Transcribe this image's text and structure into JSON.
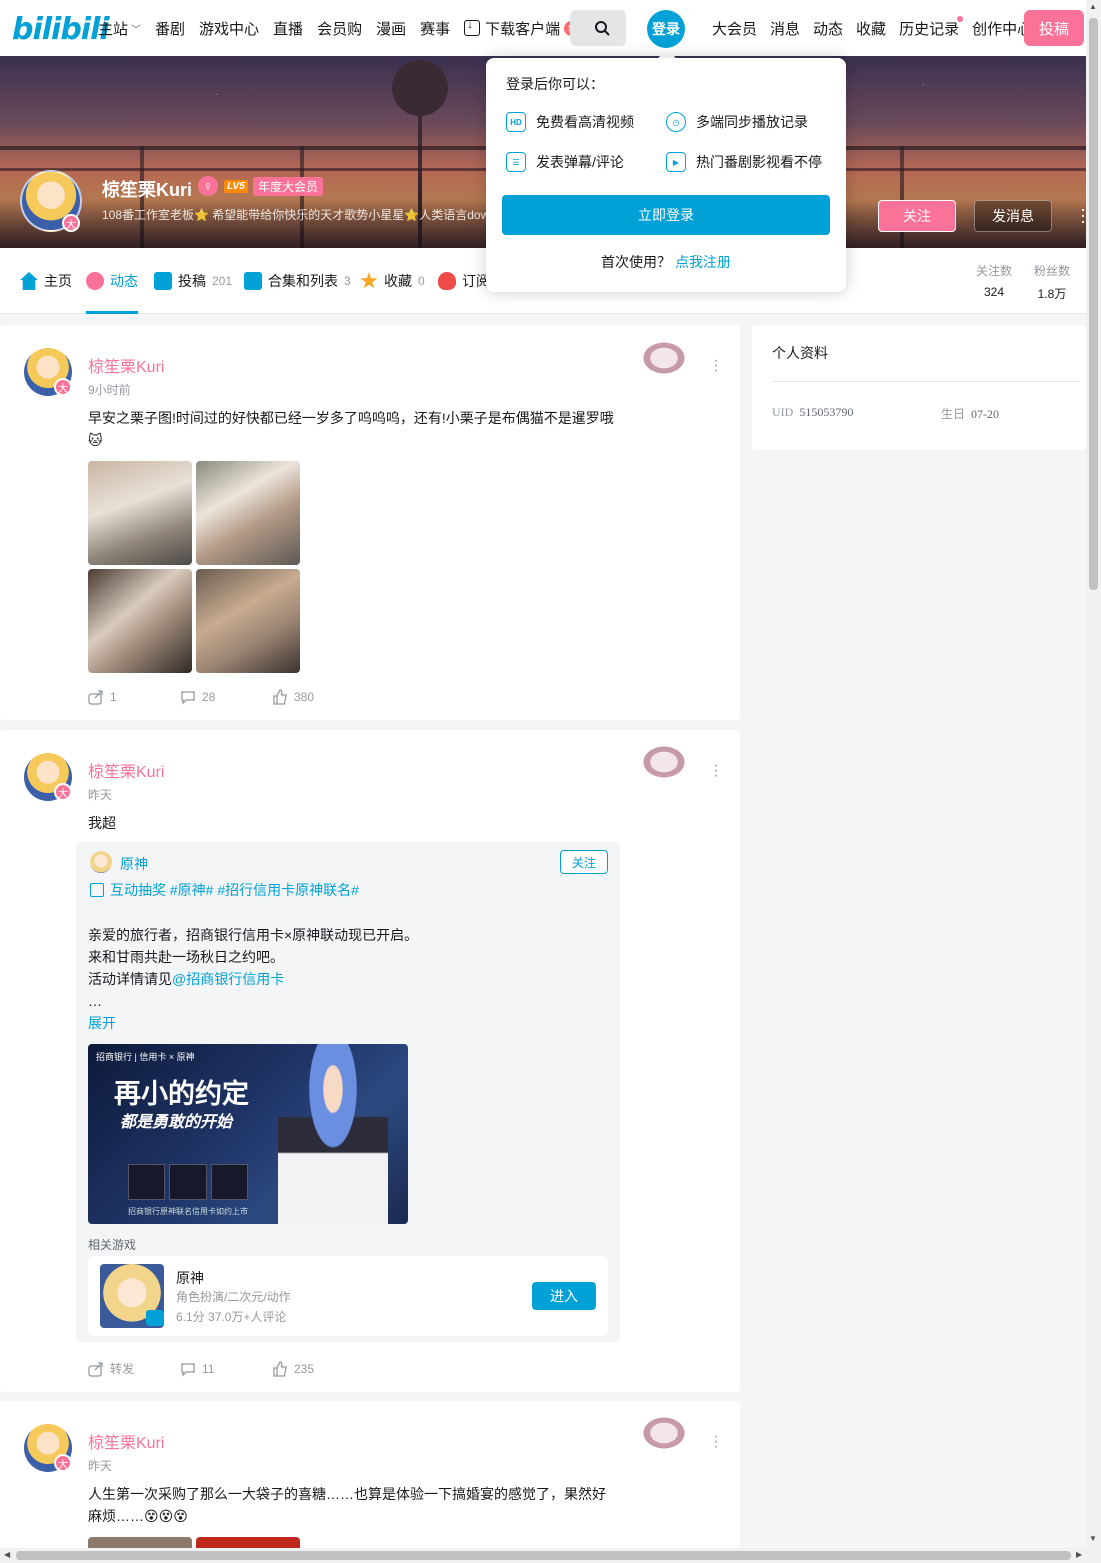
{
  "header": {
    "logo": "bilibili",
    "nav_left": [
      "主站",
      "番剧",
      "游戏中心",
      "直播",
      "会员购",
      "漫画",
      "赛事"
    ],
    "download": "下载客户端",
    "download_badge": "新",
    "login_avatar_label": "登录",
    "nav_right": [
      "大会员",
      "消息",
      "动态",
      "收藏",
      "历史记录",
      "创作中心"
    ],
    "upload": "投稿"
  },
  "profile": {
    "name": "椋笙栗Kuri",
    "level": "LV5",
    "vip": "年度大会员",
    "sign": "108番工作室老板⭐ 希望能带给你快乐的天才歌势小星星⭐人类语言dow",
    "follow": "关注",
    "message": "发消息"
  },
  "tabs": [
    {
      "label": "主页",
      "count": "",
      "color": "#00a1d6"
    },
    {
      "label": "动态",
      "count": "",
      "color": "#fb7299"
    },
    {
      "label": "投稿",
      "count": "201",
      "color": "#00a1d6"
    },
    {
      "label": "合集和列表",
      "count": "3",
      "color": "#00a1d6"
    },
    {
      "label": "收藏",
      "count": "0",
      "color": "#f5a623"
    },
    {
      "label": "订阅",
      "count": "",
      "color": "#f04b4b"
    }
  ],
  "stats": {
    "following_label": "关注数",
    "following": "324",
    "fans_label": "粉丝数",
    "fans": "1.8万"
  },
  "posts": [
    {
      "author": "椋笙栗Kuri",
      "time": "9小时前",
      "text": "早安之栗子图!时间过的好快都已经一岁多了呜呜呜，还有!小栗子是布偶猫不是暹罗哦🐱",
      "forward": "1",
      "comment": "28",
      "like": "380"
    },
    {
      "author": "椋笙栗Kuri",
      "time": "昨天",
      "text": "我超",
      "forward": "转发",
      "comment": "11",
      "like": "235"
    },
    {
      "author": "椋笙栗Kuri",
      "time": "昨天",
      "text": "人生第一次采购了那么一大袋子的喜糖……也算是体验一下搞婚宴的感觉了，果然好麻烦……😵😵😵"
    }
  ],
  "forwarded": {
    "author": "原神",
    "follow": "关注",
    "tags": "互动抽奖 #原神# #招行信用卡原神联名#",
    "line1": "亲爱的旅行者，招商银行信用卡×原神联动现已开启。",
    "line2": "来和甘雨共赴一场秋日之约吧。",
    "line3_prefix": "活动详情请见",
    "line3_link": "@招商银行信用卡",
    "ellipsis": "…",
    "expand": "展开",
    "img_header": "招商银行 | 信用卡 × 原神",
    "img_big": "再小的约定",
    "img_sub": "都是勇敢的开始",
    "img_foot": "招商银行原神联名信用卡如约上市",
    "game_label": "相关游戏",
    "game_name": "原神",
    "game_genre": "角色扮演/二次元/动作",
    "game_rating": "6.1分 37.0万+人评论",
    "game_enter": "进入"
  },
  "sidebar": {
    "title": "个人资料",
    "uid_label": "UID",
    "uid": "515053790",
    "bday_label": "生日",
    "bday": "07-20"
  },
  "login_popup": {
    "title": "登录后你可以：",
    "features": [
      "免费看高清视频",
      "多端同步播放记录",
      "发表弹幕/评论",
      "热门番剧影视看不停"
    ],
    "button": "立即登录",
    "first_use": "首次使用？",
    "register": "点我注册"
  }
}
